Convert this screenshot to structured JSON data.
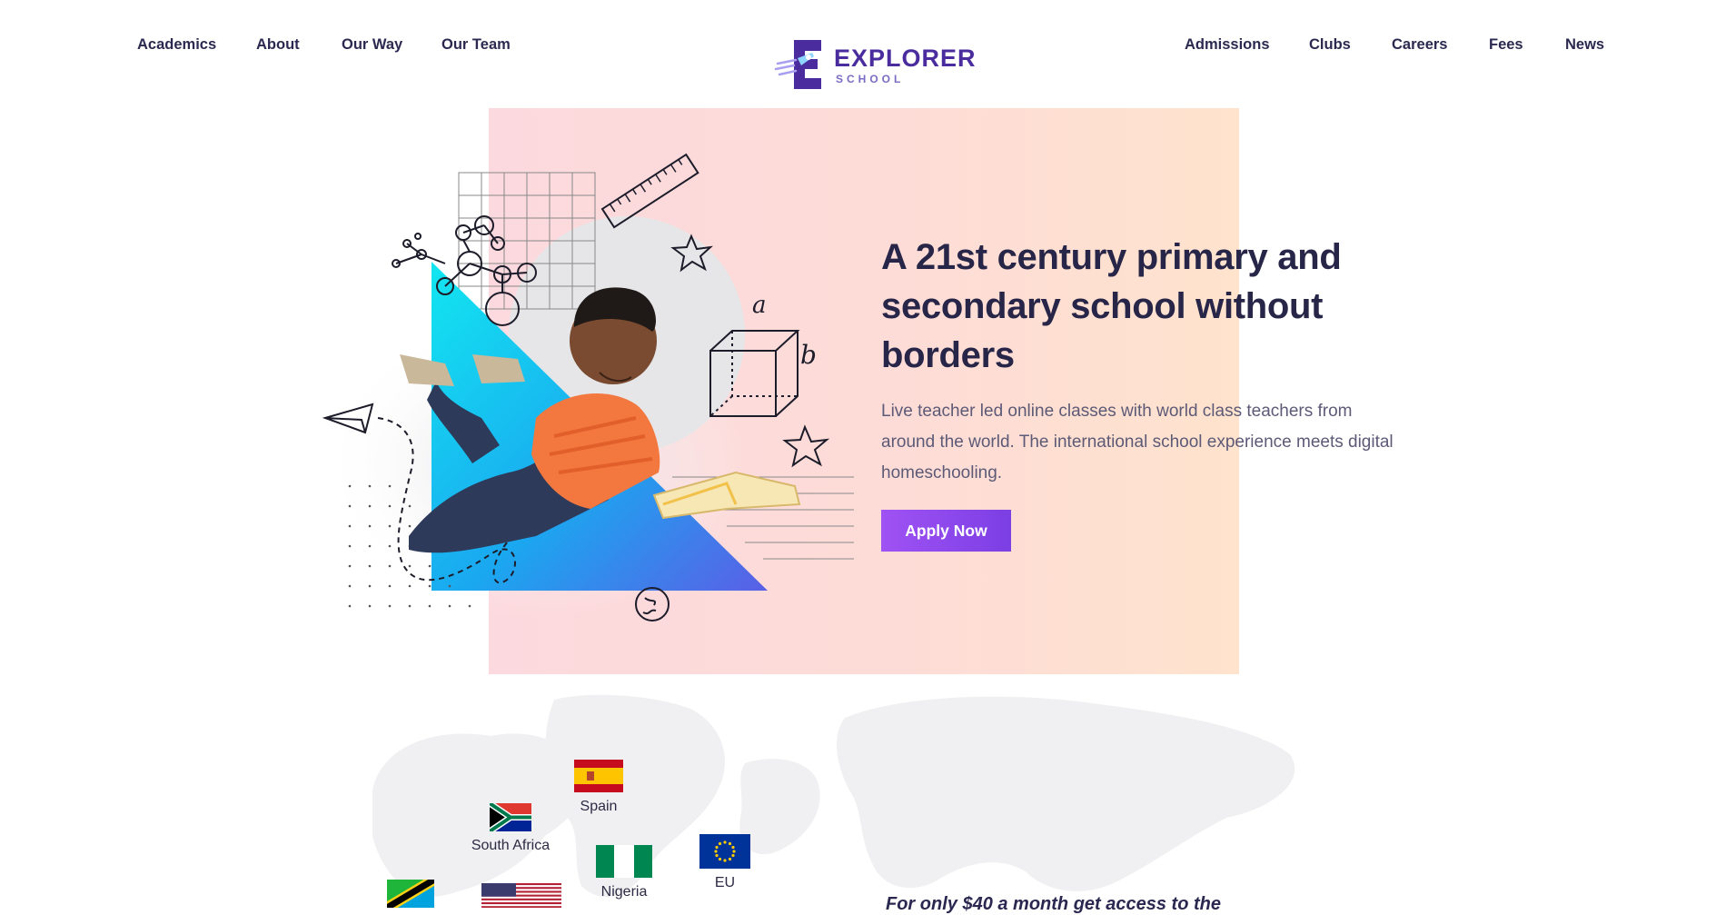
{
  "nav": {
    "left": [
      "Academics",
      "About",
      "Our Way",
      "Our Team"
    ],
    "right": [
      "Admissions",
      "Clubs",
      "Careers",
      "Fees",
      "News"
    ]
  },
  "logo": {
    "word": "EXPLORER",
    "sub": "SCHOOL"
  },
  "hero": {
    "headline": "A 21st century primary and secondary school without borders",
    "subtext": "Live teacher led online classes with world class teachers from around the world. The international school experience meets digital homeschooling.",
    "cta": "Apply Now",
    "art_letters": [
      "a",
      "b"
    ]
  },
  "flags": {
    "spain": "Spain",
    "south_africa": "South Africa",
    "nigeria": "Nigeria",
    "eu": "EU"
  },
  "promo": {
    "tagline": "For only $40 a month get access to the"
  },
  "colors": {
    "brand": "#4a2c9f",
    "cta_start": "#a052f4",
    "cta_end": "#7b3fe4",
    "hero_pink": "#fcd9de",
    "hero_peach": "#ffe3cd",
    "text_dark": "#272648"
  }
}
